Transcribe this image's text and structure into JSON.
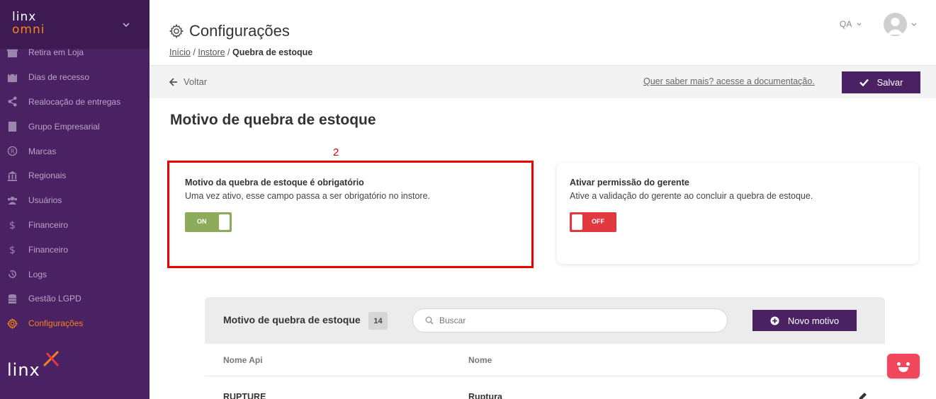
{
  "brand": {
    "line1": "linx",
    "line2": "omni"
  },
  "sidebar": {
    "items": [
      {
        "label": "Retira em Loja",
        "icon": "store-icon"
      },
      {
        "label": "Dias de recesso",
        "icon": "calendar-icon"
      },
      {
        "label": "Realocação de entregas",
        "icon": "share-icon"
      },
      {
        "label": "Grupo Empresarial",
        "icon": "building-icon"
      },
      {
        "label": "Marcas",
        "icon": "registered-icon"
      },
      {
        "label": "Regionais",
        "icon": "bank-icon"
      },
      {
        "label": "Usuários",
        "icon": "users-icon"
      },
      {
        "label": "Financeiro",
        "icon": "dollar-icon"
      },
      {
        "label": "Financeiro",
        "icon": "dollar-icon"
      },
      {
        "label": "Logs",
        "icon": "history-icon"
      },
      {
        "label": "Gestão LGPD",
        "icon": "database-icon"
      },
      {
        "label": "Configurações",
        "icon": "gear-icon",
        "active": true
      }
    ],
    "footer_logo": "linx"
  },
  "header": {
    "title": "Configurações",
    "breadcrumb": {
      "home": "Início",
      "sep": "/",
      "parent": "Instore",
      "current": "Quebra de estoque"
    },
    "env": "QA"
  },
  "actionbar": {
    "back_label": "Voltar",
    "doc_link": "Quer saber mais? acesse a documentação.",
    "save_label": "Salvar"
  },
  "main": {
    "section_title": "Motivo de quebra de estoque",
    "annotation": "2",
    "cards": [
      {
        "title": "Motivo da quebra de estoque é obrigatório",
        "desc": "Uma vez ativo, esse campo passa a ser obrigatório no instore.",
        "toggle": "ON"
      },
      {
        "title": "Ativar permissão do gerente",
        "desc": "Ative a validação do gerente ao concluir a quebra de estoque.",
        "toggle": "OFF"
      }
    ]
  },
  "table": {
    "title": "Motivo de quebra de estoque",
    "count": "14",
    "search_placeholder": "Buscar",
    "new_label": "Novo motivo",
    "columns": [
      "Nome Api",
      "Nome"
    ],
    "rows": [
      {
        "api": "RUPTURE",
        "name": "Ruptura"
      }
    ]
  },
  "colors": {
    "primary": "#4a2163",
    "accent": "#f58220",
    "on": "#8cab5b",
    "off": "#e2383f",
    "highlight": "#ee0000"
  }
}
